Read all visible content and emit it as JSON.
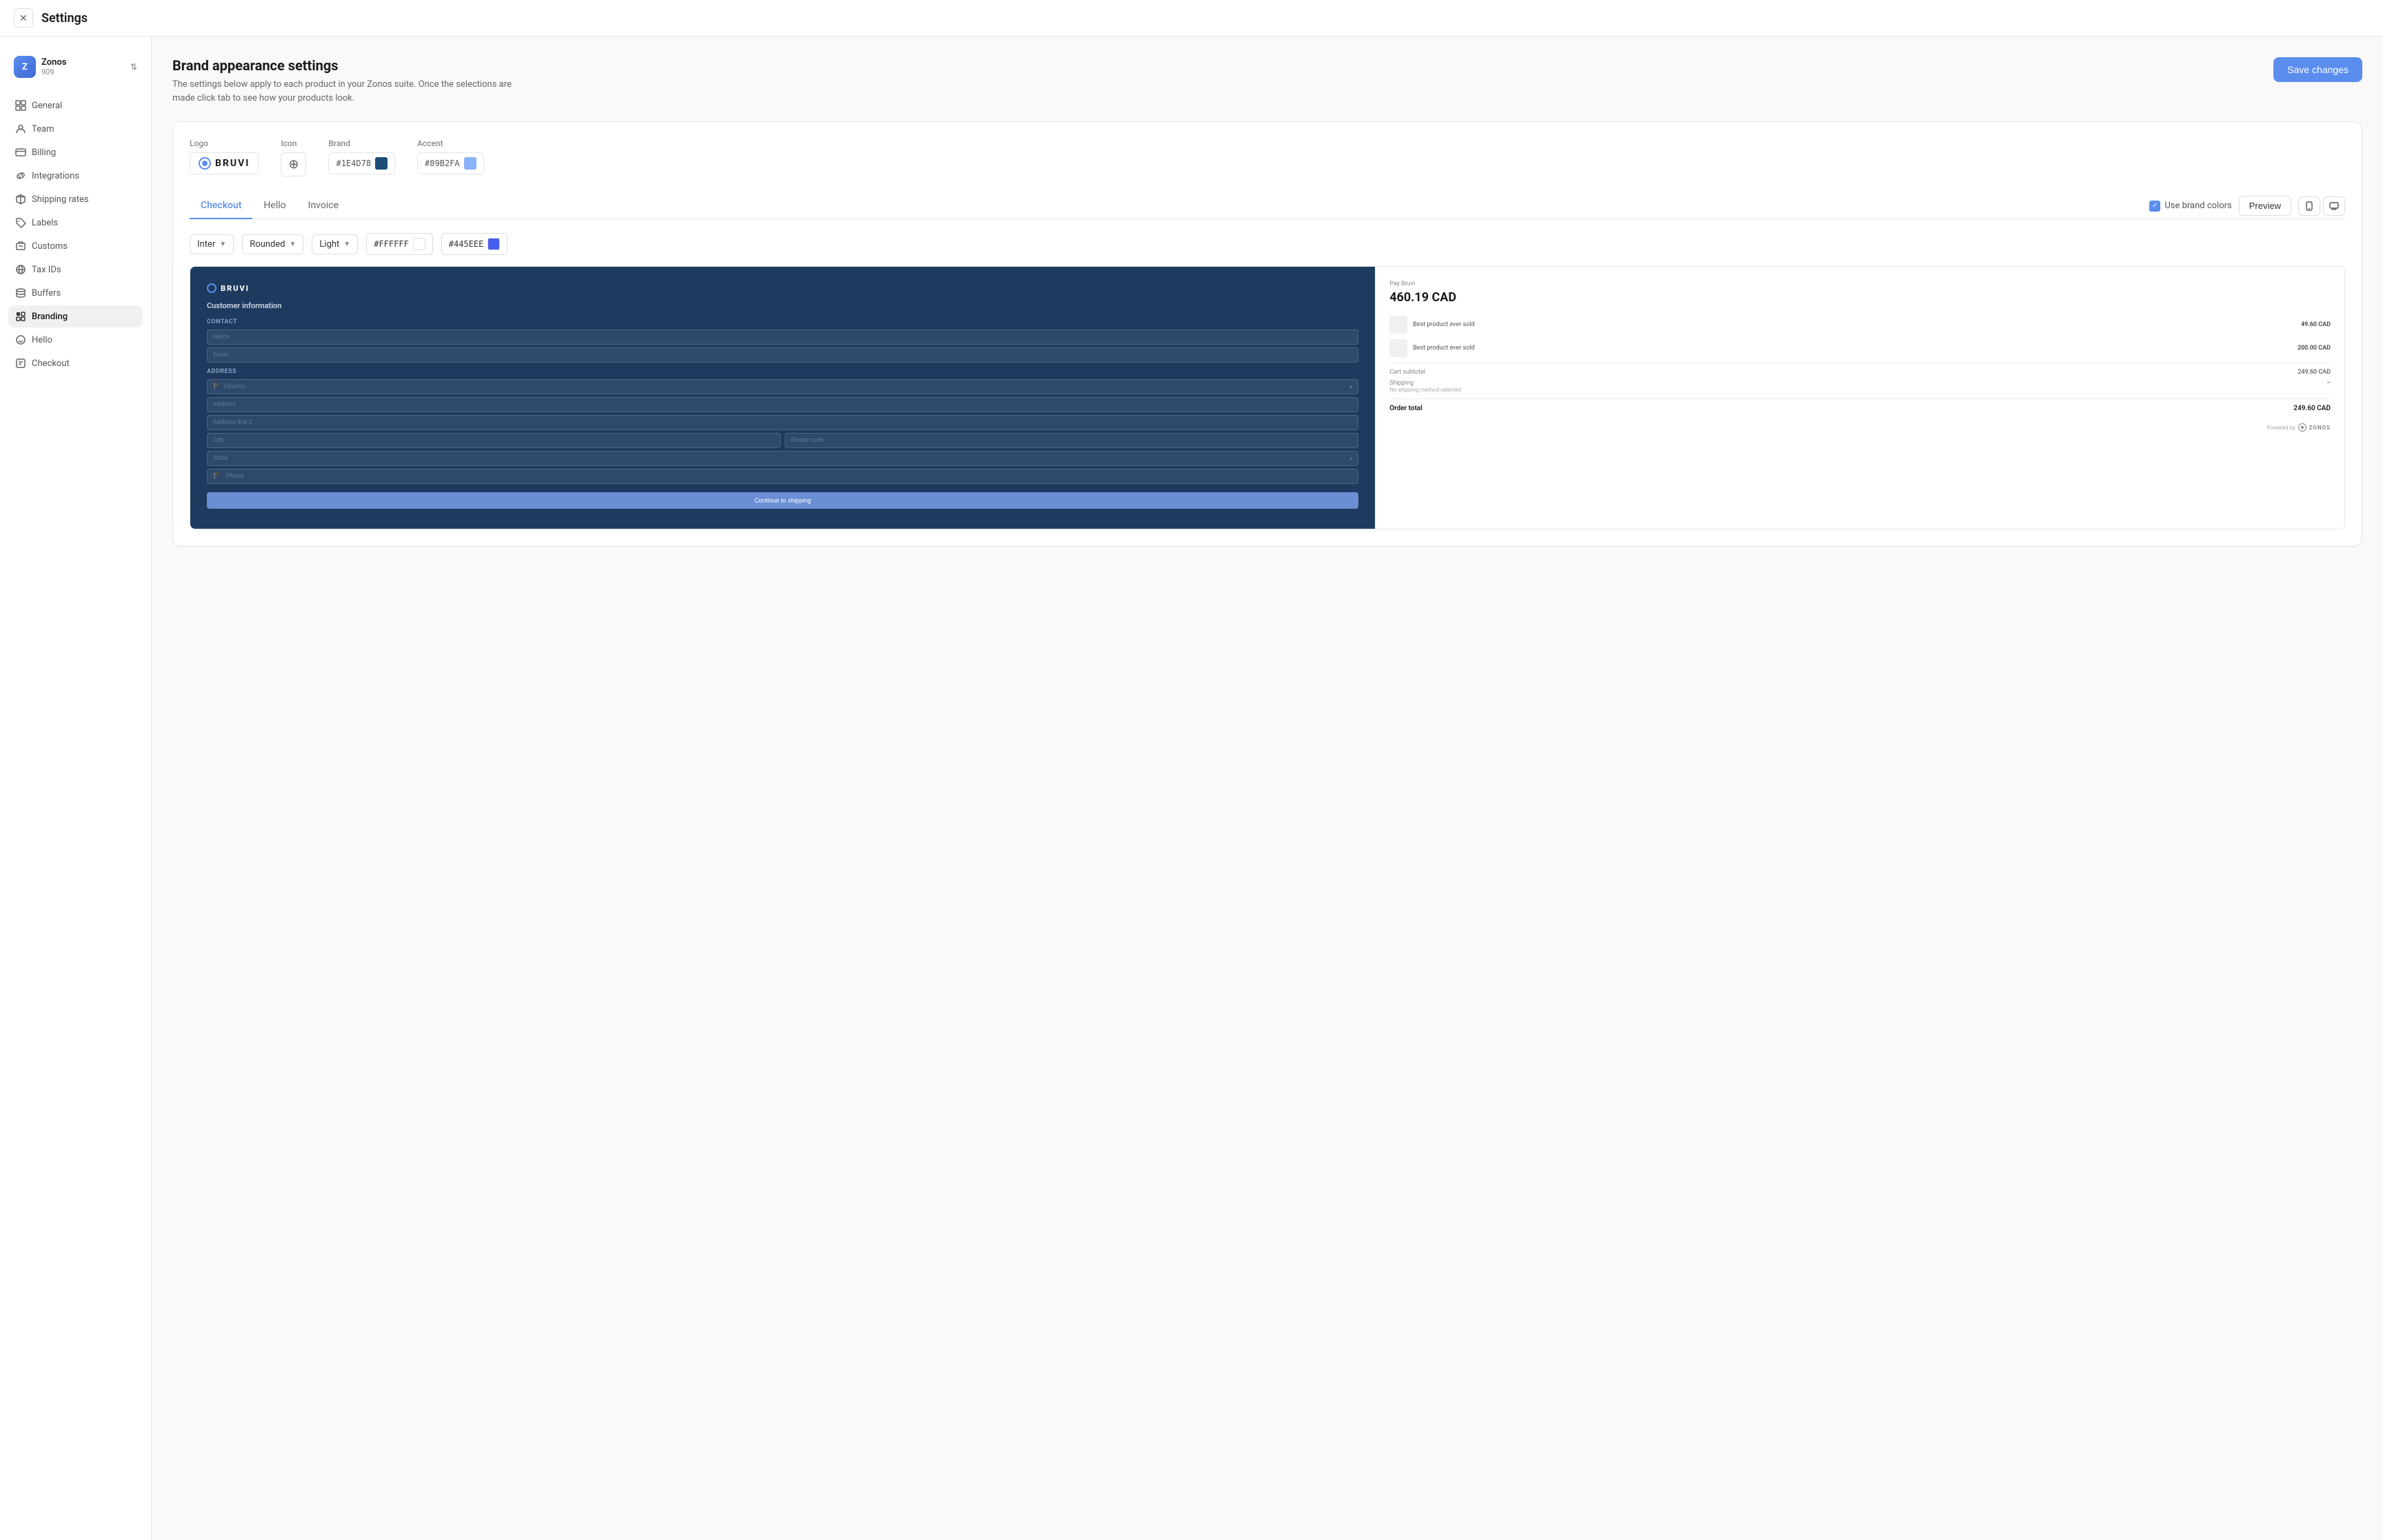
{
  "window": {
    "title": "Settings"
  },
  "sidebar": {
    "account": {
      "initial": "Z",
      "name": "Zonos",
      "id": "909"
    },
    "nav_items": [
      {
        "id": "general",
        "label": "General",
        "icon": "grid-icon",
        "active": false
      },
      {
        "id": "team",
        "label": "Team",
        "icon": "user-icon",
        "active": false
      },
      {
        "id": "billing",
        "label": "Billing",
        "icon": "credit-card-icon",
        "active": false
      },
      {
        "id": "integrations",
        "label": "Integrations",
        "icon": "link-icon",
        "active": false
      },
      {
        "id": "shipping-rates",
        "label": "Shipping rates",
        "icon": "package-icon",
        "active": false
      },
      {
        "id": "labels",
        "label": "Labels",
        "icon": "tag-icon",
        "active": false
      },
      {
        "id": "customs",
        "label": "Customs",
        "icon": "customs-icon",
        "active": false
      },
      {
        "id": "tax-ids",
        "label": "Tax IDs",
        "icon": "globe-icon",
        "active": false
      },
      {
        "id": "buffers",
        "label": "Buffers",
        "icon": "stack-icon",
        "active": false
      },
      {
        "id": "branding",
        "label": "Branding",
        "icon": "brand-icon",
        "active": true
      },
      {
        "id": "hello",
        "label": "Hello",
        "icon": "hello-icon",
        "active": false
      },
      {
        "id": "checkout",
        "label": "Checkout",
        "icon": "checkout-icon",
        "active": false
      }
    ]
  },
  "page": {
    "title": "Brand appearance settings",
    "subtitle": "The settings below apply to each product in your Zonos suite. Once the selections are made click tab to see how your products look.",
    "save_button": "Save changes"
  },
  "brand_fields": {
    "logo_label": "Logo",
    "logo_text": "BRUVI",
    "icon_label": "Icon",
    "brand_label": "Brand",
    "brand_color": "#1E4D78",
    "accent_label": "Accent",
    "accent_color": "#89B2FA"
  },
  "tabs": {
    "items": [
      {
        "id": "checkout",
        "label": "Checkout",
        "active": true
      },
      {
        "id": "hello",
        "label": "Hello",
        "active": false
      },
      {
        "id": "invoice",
        "label": "Invoice",
        "active": false
      }
    ],
    "use_brand_colors": "Use brand colors",
    "preview_button": "Preview"
  },
  "style_controls": {
    "font": "Inter",
    "shape": "Rounded",
    "theme": "Light",
    "bg_color": "#FFFFFF",
    "accent_color": "#445EEE"
  },
  "checkout_preview": {
    "logo_text": "BRUVI",
    "form_title": "Customer information",
    "sections": {
      "contact": "Contact",
      "address": "Address"
    },
    "fields": {
      "name": "Name",
      "email": "Email",
      "country": "Country",
      "address": "Address",
      "address_line_2": "Address line 2",
      "city": "City",
      "postal_code": "Postal code",
      "state": "State",
      "phone": "Phone"
    },
    "continue_button": "Continue to shipping"
  },
  "order_summary": {
    "label": "Pay Bruvi",
    "amount": "460.19 CAD",
    "items": [
      {
        "name": "Best product ever sold",
        "price": "49.60 CAD"
      },
      {
        "name": "Best product ever sold",
        "price": "200.00 CAD"
      }
    ],
    "cart_subtotal_label": "Cart subtotal",
    "cart_subtotal": "249.60 CAD",
    "shipping_label": "Shipping",
    "shipping_value": "–",
    "shipping_note": "No shipping method selected",
    "order_total_label": "Order total",
    "order_total": "249.60 CAD",
    "powered_by": "Powered by",
    "zonos_label": "ZONOS"
  }
}
